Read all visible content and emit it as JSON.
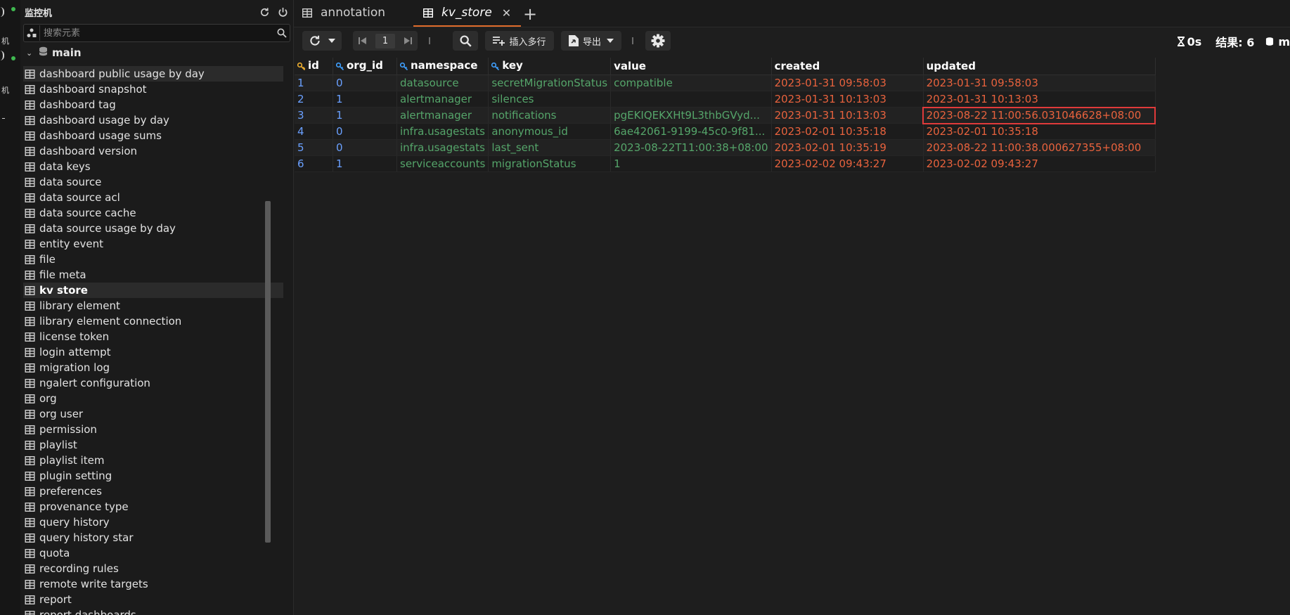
{
  "rail": {
    "labels": [
      "机",
      "机"
    ]
  },
  "sidebar": {
    "title": "监控机",
    "search_placeholder": "搜索元素",
    "database": "main",
    "items": [
      "dashboard public usage by day",
      "dashboard snapshot",
      "dashboard tag",
      "dashboard usage by day",
      "dashboard usage sums",
      "dashboard version",
      "data keys",
      "data source",
      "data source acl",
      "data source cache",
      "data source usage by day",
      "entity event",
      "file",
      "file meta",
      "kv store",
      "library element",
      "library element connection",
      "license token",
      "login attempt",
      "migration log",
      "ngalert configuration",
      "org",
      "org user",
      "permission",
      "playlist",
      "playlist item",
      "plugin setting",
      "preferences",
      "provenance type",
      "query history",
      "query history star",
      "quota",
      "recording rules",
      "remote write targets",
      "report",
      "report dashboards"
    ],
    "active_item": "kv store"
  },
  "tabs": [
    {
      "label": "annotation"
    },
    {
      "label": "kv_store"
    }
  ],
  "toolbar": {
    "page": "1",
    "insert_label": "插入多行",
    "export_label": "导出",
    "time": "0s",
    "result": "结果: 6"
  },
  "table": {
    "columns": [
      "id",
      "org_id",
      "namespace",
      "key",
      "value",
      "created",
      "updated"
    ],
    "rows": [
      [
        "1",
        "0",
        "datasource",
        "secretMigrationStatus",
        "compatible",
        "2023-01-31 09:58:03",
        "2023-01-31 09:58:03"
      ],
      [
        "2",
        "1",
        "alertmanager",
        "silences",
        "",
        "2023-01-31 10:13:03",
        "2023-01-31 10:13:03"
      ],
      [
        "3",
        "1",
        "alertmanager",
        "notifications",
        "pgEKIQEKXHt9L3thbGVyd...",
        "2023-01-31 10:13:03",
        "2023-08-22 11:00:56.031046628+08:00"
      ],
      [
        "4",
        "0",
        "infra.usagestats",
        "anonymous_id",
        "6ae42061-9199-45c0-9f81...",
        "2023-02-01 10:35:18",
        "2023-02-01 10:35:18"
      ],
      [
        "5",
        "0",
        "infra.usagestats",
        "last_sent",
        "2023-08-22T11:00:38+08:00",
        "2023-02-01 10:35:19",
        "2023-08-22 11:00:38.000627355+08:00"
      ],
      [
        "6",
        "1",
        "serviceaccounts",
        "migrationStatus",
        "1",
        "2023-02-02 09:43:27",
        "2023-02-02 09:43:27"
      ]
    ]
  },
  "colors": {
    "accent": "#e06c2b",
    "id_color": "#6aa0ff",
    "text_green": "#55a56a",
    "date_red": "#e8623d",
    "highlight_box": "#e03a3a"
  }
}
